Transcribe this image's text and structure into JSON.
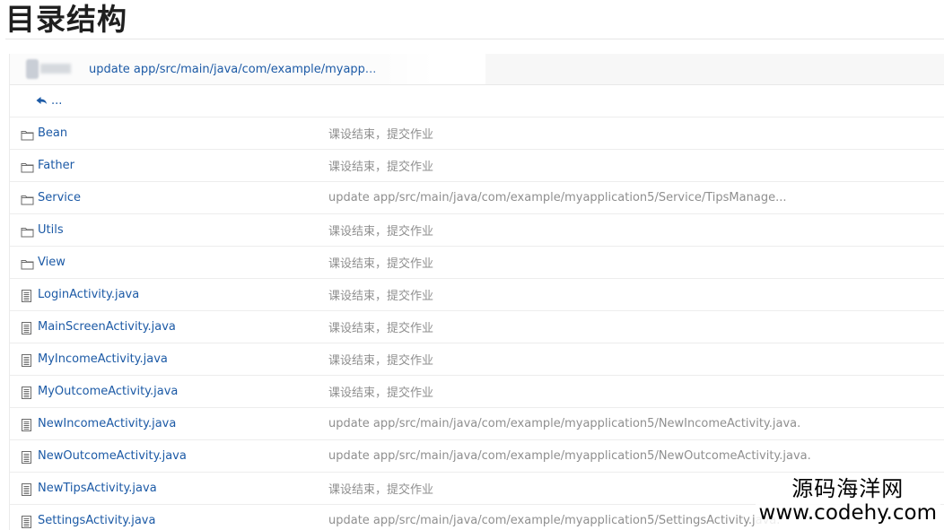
{
  "heading": "目录结构",
  "commit_bar": {
    "message": "update app/src/main/java/com/example/myapp..."
  },
  "parent_link": "...",
  "entries": [
    {
      "type": "folder",
      "name": "Bean",
      "message": "课设结束，提交作业"
    },
    {
      "type": "folder",
      "name": "Father",
      "message": "课设结束，提交作业"
    },
    {
      "type": "folder",
      "name": "Service",
      "message": "update app/src/main/java/com/example/myapplication5/Service/TipsManage..."
    },
    {
      "type": "folder",
      "name": "Utils",
      "message": "课设结束，提交作业"
    },
    {
      "type": "folder",
      "name": "View",
      "message": "课设结束，提交作业"
    },
    {
      "type": "file",
      "name": "LoginActivity.java",
      "message": "课设结束，提交作业"
    },
    {
      "type": "file",
      "name": "MainScreenActivity.java",
      "message": "课设结束，提交作业"
    },
    {
      "type": "file",
      "name": "MyIncomeActivity.java",
      "message": "课设结束，提交作业"
    },
    {
      "type": "file",
      "name": "MyOutcomeActivity.java",
      "message": "课设结束，提交作业"
    },
    {
      "type": "file",
      "name": "NewIncomeActivity.java",
      "message": "update app/src/main/java/com/example/myapplication5/NewIncomeActivity.java."
    },
    {
      "type": "file",
      "name": "NewOutcomeActivity.java",
      "message": "update app/src/main/java/com/example/myapplication5/NewOutcomeActivity.java."
    },
    {
      "type": "file",
      "name": "NewTipsActivity.java",
      "message": "课设结束，提交作业"
    },
    {
      "type": "file",
      "name": "SettingsActivity.java",
      "message": "update app/src/main/java/com/example/myapplication5/SettingsActivity.java."
    }
  ],
  "watermark": {
    "line1": "源码海洋网",
    "line2": "www.codehy.com"
  },
  "colors": {
    "link": "#1c5aa6",
    "muted": "#8f8f8f",
    "icon": "#6b6b6b"
  }
}
